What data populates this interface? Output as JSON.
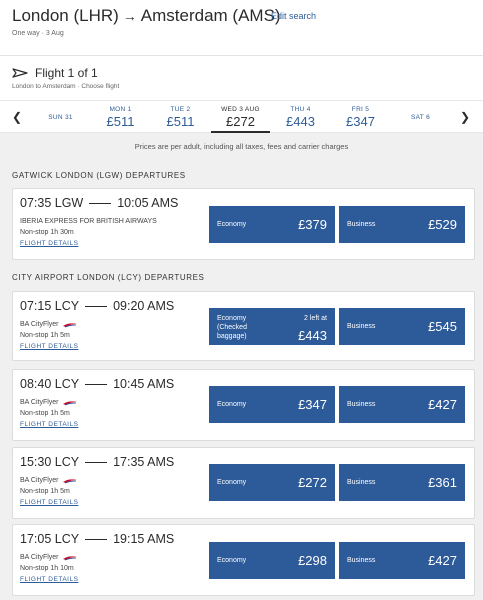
{
  "header": {
    "origin": "London (LHR)",
    "destination": "Amsterdam (AMS)",
    "edit_label": "Edit search",
    "subline": "One way · 3 Aug"
  },
  "flight": {
    "title": "Flight 1 of 1",
    "subtitle": "London to Amsterdam · Choose flight"
  },
  "dates": [
    {
      "label": "SUN 31",
      "price": ""
    },
    {
      "label": "MON 1",
      "price": "£511"
    },
    {
      "label": "TUE 2",
      "price": "£511"
    },
    {
      "label": "WED 3 AUG",
      "price": "£272",
      "active": true
    },
    {
      "label": "THU 4",
      "price": "£443"
    },
    {
      "label": "FRI 5",
      "price": "£347"
    },
    {
      "label": "SAT 6",
      "price": ""
    }
  ],
  "price_note": "Prices are per adult, including all taxes, fees and carrier charges",
  "sections": {
    "gatwick": "GATWICK LONDON (LGW) DEPARTURES",
    "city": "CITY AIRPORT LONDON (LCY) DEPARTURES"
  },
  "flights": [
    {
      "dep": "07:35 LGW",
      "arr": "10:05 AMS",
      "carrier": "IBERIA EXPRESS FOR BRITISH AIRWAYS",
      "stops": "Non-stop  1h 30m",
      "details": "FLIGHT DETAILS",
      "economy_label": "Economy",
      "economy_price": "£379",
      "business_label": "Business",
      "business_price": "£529"
    },
    {
      "dep": "07:15 LCY",
      "arr": "09:20 AMS",
      "carrier": "BA CityFlyer",
      "stops": "Non-stop  1h 5m",
      "details": "FLIGHT DETAILS",
      "economy_label": "Economy (Checked baggage)",
      "economy_left": "2 left at",
      "economy_price": "£443",
      "business_label": "Business",
      "business_price": "£545"
    },
    {
      "dep": "08:40 LCY",
      "arr": "10:45 AMS",
      "carrier": "BA CityFlyer",
      "stops": "Non-stop  1h 5m",
      "details": "FLIGHT DETAILS",
      "economy_label": "Economy",
      "economy_price": "£347",
      "business_label": "Business",
      "business_price": "£427"
    },
    {
      "dep": "15:30 LCY",
      "arr": "17:35 AMS",
      "carrier": "BA CityFlyer",
      "stops": "Non-stop  1h 5m",
      "details": "FLIGHT DETAILS",
      "economy_label": "Economy",
      "economy_price": "£272",
      "business_label": "Business",
      "business_price": "£361"
    },
    {
      "dep": "17:05 LCY",
      "arr": "19:15 AMS",
      "carrier": "BA CityFlyer",
      "stops": "Non-stop  1h 10m",
      "details": "FLIGHT DETAILS",
      "economy_label": "Economy",
      "economy_price": "£298",
      "business_label": "Business",
      "business_price": "£427"
    }
  ],
  "icons": {
    "plane": "plane-icon",
    "prev": "chevron-left-icon",
    "next": "chevron-right-icon",
    "carrier_logo": "british-airways-logo"
  },
  "colors": {
    "fare_button": "#2d5a99",
    "link": "#2e5c99",
    "background": "#f0f0f0"
  }
}
